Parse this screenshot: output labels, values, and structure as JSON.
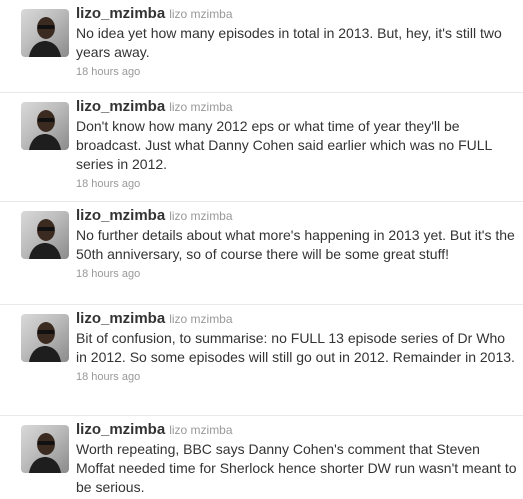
{
  "tweets": [
    {
      "username": "lizo_mzimba",
      "fullname": "lizo mzimba",
      "text": "No idea yet how many episodes in total in 2013. But, hey, it's still two years away.",
      "time": "18 hours ago"
    },
    {
      "username": "lizo_mzimba",
      "fullname": "lizo mzimba",
      "text": "Don't know how many 2012 eps or what time of year they'll be broadcast. Just what Danny Cohen said earlier which was no FULL series in 2012.",
      "time": "18 hours ago"
    },
    {
      "username": "lizo_mzimba",
      "fullname": "lizo mzimba",
      "text": "No further details about what more's happening in 2013 yet. But it's the 50th anniversary, so of course there will be some great stuff!",
      "time": "18 hours ago"
    },
    {
      "username": "lizo_mzimba",
      "fullname": "lizo mzimba",
      "text": "Bit of confusion, to summarise: no FULL 13 episode series of Dr Who in 2012. So some episodes will still go out in 2012. Remainder in 2013.",
      "time": "18 hours ago"
    },
    {
      "username": "lizo_mzimba",
      "fullname": "lizo mzimba",
      "text": "Worth repeating, BBC says Danny Cohen's comment that Steven Moffat needed time for Sherlock hence shorter DW run wasn't meant to be serious.",
      "time": ""
    }
  ]
}
